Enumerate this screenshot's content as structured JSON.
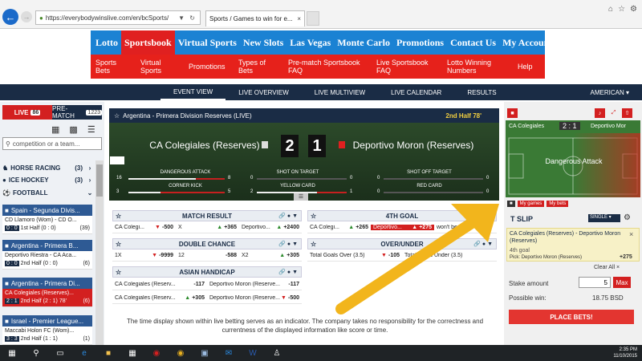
{
  "browser": {
    "url": "https://everybodywinslive.com/en/bcSports/",
    "tab_title": "Sports / Games to win for e..."
  },
  "site_nav": {
    "top": [
      "Lotto",
      "Sportsbook",
      "Virtual Sports",
      "New Slots",
      "Las Vegas",
      "Monte Carlo",
      "Promotions",
      "Contact Us",
      "My Account"
    ],
    "sub": [
      "Sports Bets",
      "Virtual Sports",
      "Promotions",
      "Types of Bets",
      "Pre-match Sportsbook FAQ",
      "Live Sportsbook FAQ",
      "Lotto Winning Numbers",
      "Help"
    ]
  },
  "app_tabs": [
    "EVENT VIEW",
    "LIVE OVERVIEW",
    "LIVE MULTIVIEW",
    "LIVE CALENDAR",
    "RESULTS"
  ],
  "language": "AMERICAN",
  "sidebar": {
    "live_label": "LIVE",
    "live_count": "86",
    "prematch_label": "PRE-MATCH",
    "prematch_count": "1223",
    "search_placeholder": "competition or a team...",
    "sports": [
      {
        "name": "HORSE RACING",
        "count": "(3)"
      },
      {
        "name": "ICE HOCKEY",
        "count": "(3)"
      },
      {
        "name": "FOOTBALL",
        "count": ""
      }
    ],
    "leagues": [
      {
        "name": "Spain - Segunda Divis...",
        "match": "CD Llamoro (Wom) - CD O...",
        "score": "0 : 0",
        "period": "1st Half",
        "score2": "(0 : 0)",
        "extra": "(39)"
      },
      {
        "name": "Argentina - Primera B...",
        "match": "Deportivo Riestra - CA Aca...",
        "score": "0 : 0",
        "period": "2nd Half",
        "score2": "(0 : 0)",
        "extra": "(6)"
      },
      {
        "name": "Argentina - Primera Di...",
        "match": "CA Colegiales (Reserves)...",
        "score": "2 : 1",
        "period": "2nd Half",
        "score2": "(2 : 1)",
        "extra": "78'",
        "extra2": "(6)"
      },
      {
        "name": "Israel - Premier League...",
        "match": "Maccabi Holon FC (Wom)...",
        "score": "3 : 3",
        "period": "2nd Half",
        "score2": "(1 : 1)",
        "extra": "(1)"
      }
    ]
  },
  "event": {
    "title": "Argentina - Primera Division Reserves (LIVE)",
    "time": "2nd Half 78'",
    "home": "CA Colegiales (Reserves)",
    "away": "Deportivo Moron (Reserves)",
    "home_score": "2",
    "away_score": "1",
    "stats": [
      {
        "label": "DANGEROUS ATTACK",
        "home": "16",
        "away": "8"
      },
      {
        "label": "CORNER KICK",
        "home": "3",
        "away": "5"
      },
      {
        "label": "SHOT ON TARGET",
        "home": "0",
        "away": "0"
      },
      {
        "label": "YELLOW CARD",
        "home": "2",
        "away": "1"
      },
      {
        "label": "SHOT OFF TARGET",
        "home": "0",
        "away": "0"
      },
      {
        "label": "RED CARD",
        "home": "0",
        "away": "0"
      }
    ]
  },
  "markets": {
    "match_result": {
      "title": "MATCH RESULT",
      "cells": [
        {
          "label": "CA Colegi...",
          "odd": "-500",
          "dir": "dn"
        },
        {
          "label": "X",
          "odd": "+365",
          "dir": "up"
        },
        {
          "label": "Deportivo...",
          "odd": "+2400",
          "dir": "up"
        }
      ]
    },
    "fourth_goal": {
      "title": "4TH GOAL",
      "cells": [
        {
          "label": "CA Colegi...",
          "odd": "+265",
          "dir": "up"
        },
        {
          "label": "Deportivo...",
          "odd": "+275",
          "dir": "up",
          "selected": true
        },
        {
          "label": "won't be",
          "odd": "",
          "dir": ""
        }
      ]
    },
    "double_chance": {
      "title": "DOUBLE CHANCE",
      "cells": [
        {
          "label": "1X",
          "odd": "-9999",
          "dir": "dn"
        },
        {
          "label": "12",
          "odd": "-588",
          "dir": ""
        },
        {
          "label": "X2",
          "odd": "+305",
          "dir": "up"
        }
      ]
    },
    "over_under": {
      "title": "OVER/UNDER",
      "cells": [
        {
          "label": "Total Goals Over (3.5)",
          "odd": "-105",
          "dir": "dn"
        },
        {
          "label": "Total Goals Under (3.5)",
          "odd": "",
          "dir": ""
        }
      ]
    },
    "asian_handicap": {
      "title": "ASIAN HANDICAP",
      "rows": [
        [
          {
            "label": "CA Colegiales (Reserv...",
            "odd": "-117",
            "dir": ""
          },
          {
            "label": "Deportivo Moron (Reserve...",
            "odd": "-117",
            "dir": ""
          }
        ],
        [
          {
            "label": "CA Colegiales (Reserv...",
            "odd": "+305",
            "dir": "up"
          },
          {
            "label": "Deportivo Moron (Reserve...",
            "odd": "-500",
            "dir": "dn"
          }
        ]
      ]
    }
  },
  "info_text": "The time display shown within live betting serves as an indicator. The company takes no responsibility for the correctness and currentness of the displayed information like score or time.",
  "right_panel": {
    "pitch_home": "CA Colegiales",
    "pitch_score": "2 : 1",
    "pitch_away": "Deportivo Mor",
    "pitch_label": "Dangerous Attack",
    "tabs": [
      "My games",
      "My bets"
    ],
    "betslip_label": "T SLIP",
    "single": "SINGLE",
    "slip_event": "CA Colegiales (Reserves) - Deportivo Moron (Reserves)",
    "slip_goal": "4th goal",
    "slip_pick_label": "Pick:",
    "slip_pick": "Deportivo Moron (Reserves)",
    "slip_odd": "+275",
    "clear_all": "Clear All",
    "stake_label": "Stake amount",
    "stake_value": "5",
    "max": "Max",
    "possible_label": "Possible win:",
    "possible_value": "18.75 BSD",
    "place_bets": "PLACE BETS!"
  },
  "taskbar": {
    "time": "2:35 PM",
    "date": "11/10/2015"
  },
  "colors": {
    "nav_blue": "#1b82d3",
    "nav_red": "#e6211b",
    "dark_navy": "#1a2c45",
    "arrow_yellow": "#f2b51c"
  }
}
